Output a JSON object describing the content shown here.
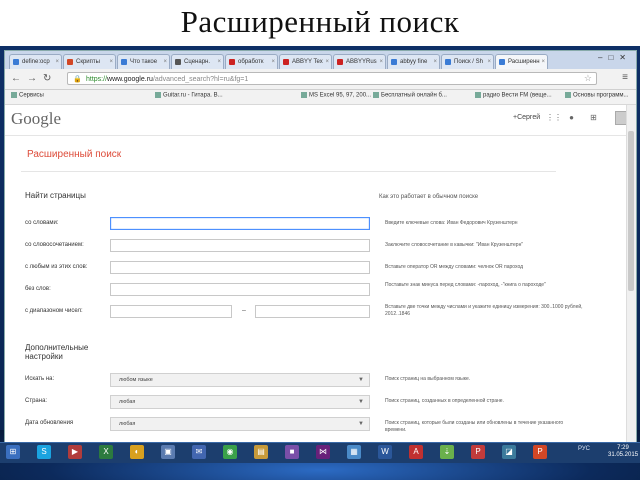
{
  "slide": {
    "title": "Расширенный поиск"
  },
  "browser": {
    "tabs": [
      {
        "label": "define:ocp",
        "color": "#3a7bd5"
      },
      {
        "label": "Скрипты",
        "color": "#d24726"
      },
      {
        "label": "Что такое",
        "color": "#3a7bd5"
      },
      {
        "label": "Сценарн.",
        "color": "#555555"
      },
      {
        "label": "обработк",
        "color": "#cc2222"
      },
      {
        "label": "ABBYY Tex",
        "color": "#cc2222"
      },
      {
        "label": "ABBYYRus",
        "color": "#cc2222"
      },
      {
        "label": "abbyy fine",
        "color": "#3a7bd5"
      },
      {
        "label": "Поиск / Sh",
        "color": "#3a7bd5"
      },
      {
        "label": "Расширенн",
        "color": "#3a7bd5",
        "active": true
      }
    ],
    "address": {
      "scheme": "https://",
      "host": "www.google.ru",
      "path": "/advanced_search?hl=ru&fg=1"
    },
    "bookmarks": [
      "Сервисы",
      "Guitar.ru - Гитара. В...",
      "MS Excel 95, 97, 200...",
      "Бесплатный онлайн б...",
      "радио Вести FM (веще...",
      "Основы программ..."
    ]
  },
  "google": {
    "logo": "Google",
    "user": "+Сергей",
    "page_title": "Расширенный поиск",
    "find_pages_title": "Найти страницы",
    "how_it_works": "Как это работает в обычном поиске",
    "fields": [
      {
        "label": "со словами:",
        "hint": "Введите ключевые слова: Иван Федорович Крузенштерн"
      },
      {
        "label": "со словосочетанием:",
        "hint": "Заключите словосочетание в кавычки: \"Иван Крузенштерн\""
      },
      {
        "label": "с любым из этих слов:",
        "hint": "Вставьте оператор OR между словами: челнок OR пароход"
      },
      {
        "label": "без слов:",
        "hint": "Поставьте знак минуса перед словами: -пароход, -\"книга о пароходе\""
      },
      {
        "label": "с диапазоном чисел:",
        "dash": "–",
        "hint": "Вставьте две точки между числами и укажите единицу измерения: 300..1000 рублей, 2012..1846"
      }
    ],
    "more_title": "Дополнительные настройки",
    "settings": [
      {
        "label": "Искать на:",
        "value": "любом языке",
        "hint": "Поиск страниц на выбранном языке."
      },
      {
        "label": "Страна:",
        "value": "любая",
        "hint": "Поиск страниц, созданных в определенной стране."
      },
      {
        "label": "Дата обновления",
        "value": "любая",
        "hint": "Поиск страниц, которые были созданы или обновлены в течение указанного времени."
      }
    ]
  },
  "taskbar": {
    "icons": [
      {
        "name": "start-icon",
        "glyph": "⊞",
        "color": "#3a6fbf"
      },
      {
        "name": "skype-icon",
        "glyph": "S",
        "color": "#1aa3e0"
      },
      {
        "name": "player-icon",
        "glyph": "▶",
        "color": "#b13c3c"
      },
      {
        "name": "excel-icon",
        "glyph": "X",
        "color": "#2c7a3f"
      },
      {
        "name": "media-icon",
        "glyph": "◐",
        "color": "#d8a01f"
      },
      {
        "name": "folder-icon",
        "glyph": "▣",
        "color": "#5a7bb0"
      },
      {
        "name": "mail-icon",
        "glyph": "✉",
        "color": "#4266b0"
      },
      {
        "name": "chrome-icon",
        "glyph": "◉",
        "color": "#3aa04a"
      },
      {
        "name": "explorer-icon",
        "glyph": "▤",
        "color": "#c79a3a"
      },
      {
        "name": "app-icon",
        "glyph": "■",
        "color": "#7a4fa8"
      },
      {
        "name": "vs-icon",
        "glyph": "⋈",
        "color": "#68217a"
      },
      {
        "name": "app2-icon",
        "glyph": "▦",
        "color": "#4a8ac8"
      },
      {
        "name": "word-icon",
        "glyph": "W",
        "color": "#2b579a"
      },
      {
        "name": "abbyy-icon",
        "glyph": "A",
        "color": "#c03030"
      },
      {
        "name": "torrent-icon",
        "glyph": "⇣",
        "color": "#6ab04c"
      },
      {
        "name": "pdf-icon",
        "glyph": "P",
        "color": "#c23b3b"
      },
      {
        "name": "photo-icon",
        "glyph": "◪",
        "color": "#3b7a9c"
      },
      {
        "name": "powerpoint-icon",
        "glyph": "P",
        "color": "#d24726"
      }
    ],
    "lang": "РУС",
    "time": "7:29",
    "date": "31.05.2015"
  }
}
